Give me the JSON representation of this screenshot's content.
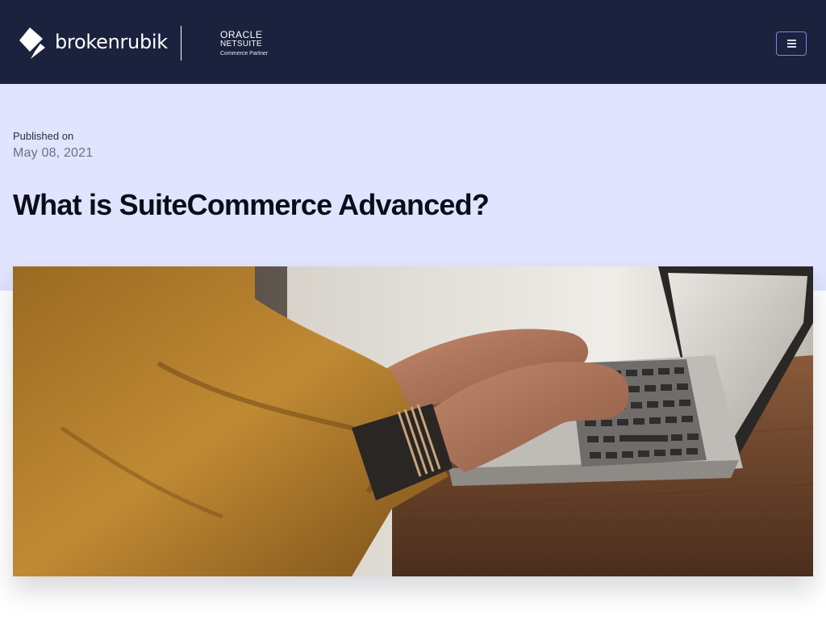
{
  "header": {
    "brand": "brokenrubik",
    "partner": {
      "line1": "ORACLE",
      "line2": "NETSUITE",
      "line3": "Commerce Partner"
    },
    "menu_icon": "hamburger-menu-icon"
  },
  "article": {
    "published_label": "Published on",
    "published_date": "May 08, 2021",
    "title": "What is SuiteCommerce Advanced?"
  },
  "colors": {
    "header_bg": "#1a223d",
    "hero_bg": "#e0e4ff",
    "menu_border": "#7a86e8"
  }
}
